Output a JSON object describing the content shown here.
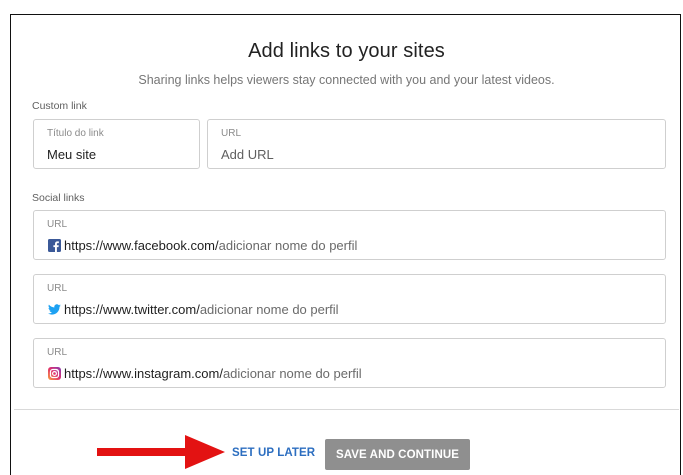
{
  "header": {
    "title": "Add links to your sites",
    "subtitle": "Sharing links helps viewers stay connected with you and your latest videos."
  },
  "custom_link": {
    "section_label": "Custom link",
    "title_field": {
      "label": "Título do link",
      "value": "Meu site"
    },
    "url_field": {
      "label": "URL",
      "placeholder": "Add URL"
    }
  },
  "social_links": {
    "section_label": "Social links",
    "items": [
      {
        "label": "URL",
        "prefix": "https://www.facebook.com/",
        "suffix": "adicionar nome do perfil",
        "icon": "facebook-icon",
        "color": "#3b5998"
      },
      {
        "label": "URL",
        "prefix": "https://www.twitter.com/",
        "suffix": "adicionar nome do perfil",
        "icon": "twitter-icon",
        "color": "#1da1f2"
      },
      {
        "label": "URL",
        "prefix": "https://www.instagram.com/",
        "suffix": "adicionar nome do perfil",
        "icon": "instagram-icon",
        "color": "#d6249f"
      }
    ]
  },
  "footer": {
    "setup_later": "SET UP LATER",
    "save_continue": "SAVE AND CONTINUE"
  },
  "colors": {
    "link_blue": "#2c6ec0",
    "button_gray": "#8f8f8f",
    "annotation_arrow": "#e31212"
  }
}
